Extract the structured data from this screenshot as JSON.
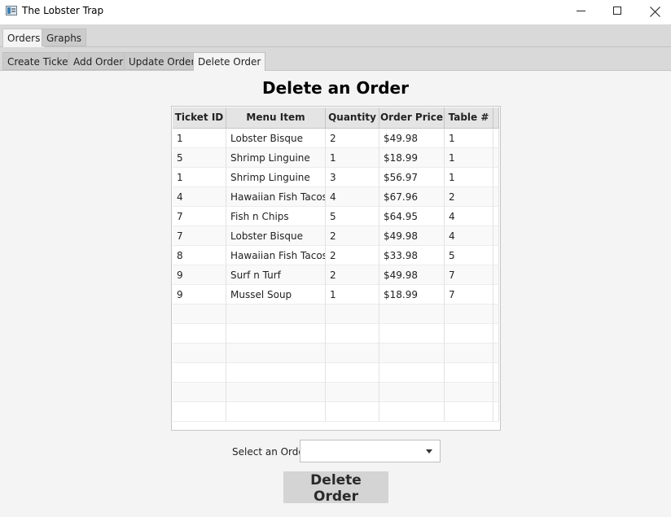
{
  "window": {
    "title": "The Lobster Trap"
  },
  "main_tabs": [
    {
      "label": "Orders",
      "selected": true
    },
    {
      "label": "Graphs",
      "selected": false
    }
  ],
  "sub_tabs": [
    {
      "label": "Create Ticket",
      "selected": false
    },
    {
      "label": "Add Order",
      "selected": false
    },
    {
      "label": "Update Order",
      "selected": false
    },
    {
      "label": "Delete Order",
      "selected": true
    }
  ],
  "page": {
    "heading": "Delete an Order"
  },
  "table": {
    "columns": [
      "Ticket ID",
      "Menu Item",
      "Quantity",
      "Order Price",
      "Table #"
    ],
    "rows": [
      [
        "1",
        "Lobster Bisque",
        "2",
        "$49.98",
        "1"
      ],
      [
        "5",
        "Shrimp Linguine",
        "1",
        "$18.99",
        "1"
      ],
      [
        "1",
        "Shrimp Linguine",
        "3",
        "$56.97",
        "1"
      ],
      [
        "4",
        "Hawaiian Fish Tacos",
        "4",
        "$67.96",
        "2"
      ],
      [
        "7",
        "Fish n Chips",
        "5",
        "$64.95",
        "4"
      ],
      [
        "7",
        "Lobster Bisque",
        "2",
        "$49.98",
        "4"
      ],
      [
        "8",
        "Hawaiian Fish Tacos",
        "2",
        "$33.98",
        "5"
      ],
      [
        "9",
        "Surf n Turf",
        "2",
        "$49.98",
        "7"
      ],
      [
        "9",
        "Mussel Soup",
        "1",
        "$18.99",
        "7"
      ]
    ]
  },
  "form": {
    "select_label": "Select an Order",
    "select_value": "",
    "delete_button": "Delete Order"
  }
}
